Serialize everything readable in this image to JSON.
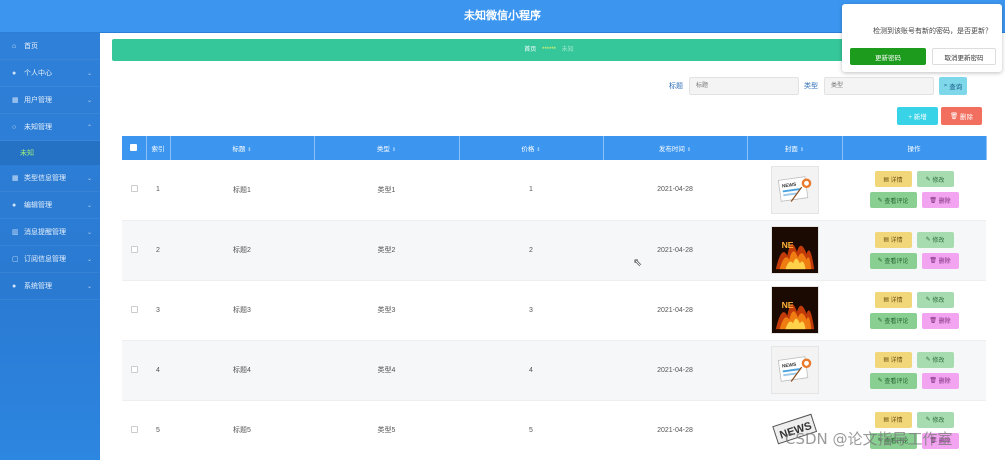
{
  "header": {
    "title": "未知微信小程序"
  },
  "sidebar": {
    "items": [
      {
        "icon": "home-icon",
        "glyph": "⌂",
        "label": "首页",
        "expandable": false
      },
      {
        "icon": "user-icon",
        "glyph": "👤",
        "label": "个人中心",
        "expandable": true
      },
      {
        "icon": "users-icon",
        "glyph": "▦",
        "label": "用户管理",
        "expandable": true
      },
      {
        "icon": "unknown-icon",
        "glyph": "○",
        "label": "未知管理",
        "expandable": true
      },
      {
        "icon": "grid-icon",
        "glyph": "▦",
        "label": "类型信息管理",
        "expandable": true
      },
      {
        "icon": "pin-icon",
        "glyph": "●",
        "label": "编辑管理",
        "expandable": true
      },
      {
        "icon": "chart-icon",
        "glyph": "▥",
        "label": "消息提醒管理",
        "expandable": true
      },
      {
        "icon": "mail-icon",
        "glyph": "▢",
        "label": "订阅信息管理",
        "expandable": true
      },
      {
        "icon": "location-icon",
        "glyph": "●",
        "label": "系统管理",
        "expandable": true
      }
    ],
    "active_sub": "未知"
  },
  "breadcrumb": {
    "home": "首页",
    "sep": "******",
    "current": "未知"
  },
  "search": {
    "title_label": "标题",
    "title_placeholder": "标题",
    "type_label": "类型",
    "type_placeholder": "类型",
    "query_label": "查询"
  },
  "toolbar": {
    "add_label": "+ 新增",
    "delete_label": "删除"
  },
  "table": {
    "headers": {
      "index": "索引",
      "title": "标题",
      "type": "类型",
      "price": "价格",
      "date": "发布时间",
      "cover": "封面",
      "ops": "操作"
    },
    "rows": [
      {
        "index": "1",
        "title": "标题1",
        "type": "类型1",
        "price": "1",
        "date": "2021-04-28",
        "cover": "news"
      },
      {
        "index": "2",
        "title": "标题2",
        "type": "类型2",
        "price": "2",
        "date": "2021-04-28",
        "cover": "fire"
      },
      {
        "index": "3",
        "title": "标题3",
        "type": "类型3",
        "price": "3",
        "date": "2021-04-28",
        "cover": "fire"
      },
      {
        "index": "4",
        "title": "标题4",
        "type": "类型4",
        "price": "4",
        "date": "2021-04-28",
        "cover": "news"
      },
      {
        "index": "5",
        "title": "标题5",
        "type": "类型5",
        "price": "5",
        "date": "2021-04-28",
        "cover": "news-stamp"
      }
    ],
    "ops": {
      "detail": "详情",
      "edit": "修改",
      "comment": "查看评论",
      "delete": "删除"
    }
  },
  "popup": {
    "message": "检测到该账号有新的密码，是否更新？",
    "ok_label": "更新密码",
    "cancel_label": "取消更新密码"
  },
  "watermark": "CSDN @论文指导工作室",
  "colors": {
    "header": "#3c96f0",
    "sidebar": "#2f80d8",
    "breadcrumb": "#35c79a",
    "accent_green": "#1d9b1d"
  }
}
